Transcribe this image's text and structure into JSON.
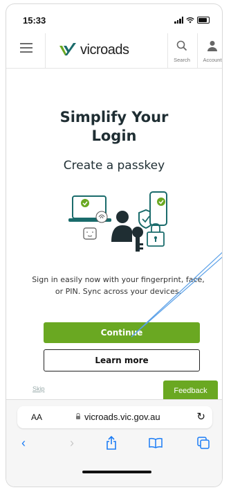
{
  "status": {
    "time": "15:33"
  },
  "header": {
    "brand": "vicroads",
    "search_label": "Search",
    "account_label": "Account"
  },
  "main": {
    "title_line1": "Simplify Your",
    "title_line2": "Login",
    "subtitle": "Create a passkey",
    "description": "Sign in easily now with your fingerprint, face, or PIN. Sync across your devices.",
    "continue_label": "Continue",
    "learn_more_label": "Learn more",
    "skip_label": "Skip",
    "feedback_label": "Feedback"
  },
  "browser": {
    "aa_label": "AA",
    "url": "vicroads.vic.gov.au"
  },
  "colors": {
    "brand_green": "#6aa822",
    "brand_teal": "#1a6b6b",
    "title_color": "#1f2e33",
    "link_blue": "#1a7cf5"
  },
  "icons": [
    "menu-icon",
    "search-icon",
    "account-icon",
    "lock-icon",
    "reload-icon",
    "back-icon",
    "forward-icon",
    "share-icon",
    "bookmarks-icon",
    "tabs-icon"
  ]
}
